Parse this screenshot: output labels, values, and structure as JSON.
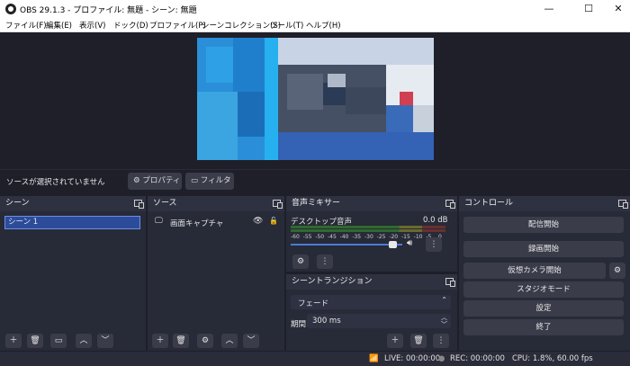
{
  "window": {
    "title": "OBS 29.1.3 - プロファイル: 無題 - シーン: 無題",
    "minimize": "—",
    "maximize": "☐",
    "close": "✕"
  },
  "menu": [
    "ファイル(F)",
    "編集(E)",
    "表示(V)",
    "ドック(D)",
    "プロファイル(P)",
    "シーンコレクション(S)",
    "ツール(T)",
    "ヘルプ(H)"
  ],
  "source_bar": {
    "status": "ソースが選択されていません",
    "properties": "プロパティ",
    "filters": "フィルタ"
  },
  "scenes": {
    "title": "シーン",
    "items": [
      "シーン 1"
    ]
  },
  "sources": {
    "title": "ソース",
    "items": [
      {
        "name": "画面キャプチャ"
      }
    ]
  },
  "mixer": {
    "title": "音声ミキサー",
    "channel": "デスクトップ音声",
    "level": "0.0 dB",
    "ticks": [
      "-60",
      "-55",
      "-50",
      "-45",
      "-40",
      "-35",
      "-30",
      "-25",
      "-20",
      "-15",
      "-10",
      "-5",
      "0"
    ],
    "volume": 0.92
  },
  "transitions": {
    "title": "シーントランジション",
    "type": "フェード",
    "duration_label": "期間",
    "duration": "300 ms"
  },
  "controls": {
    "title": "コントロール",
    "buttons": [
      "配信開始",
      "録画開始",
      "仮想カメラ開始",
      "スタジオモード",
      "設定",
      "終了"
    ]
  },
  "status": {
    "live": "LIVE: 00:00:00",
    "rec": "REC: 00:00:00",
    "perf": "CPU: 1.8%, 60.00 fps"
  }
}
